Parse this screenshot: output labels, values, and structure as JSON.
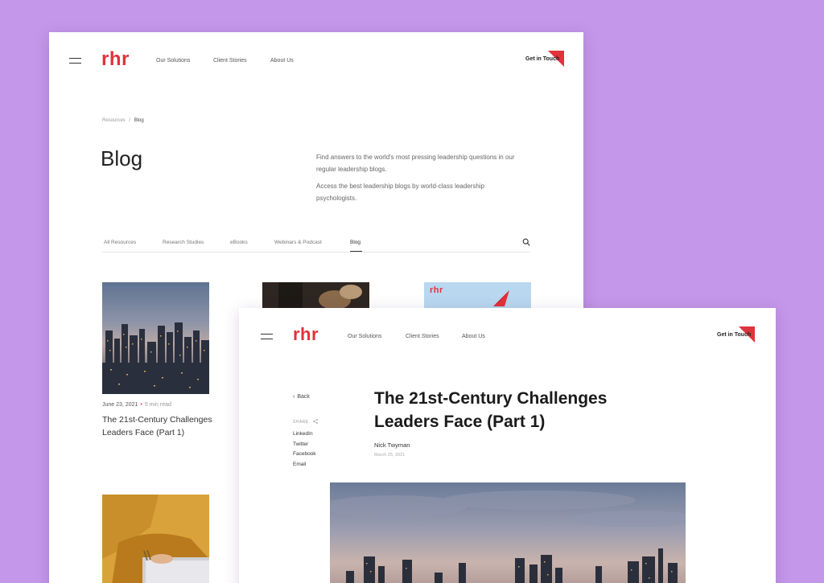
{
  "brand": {
    "logo": "rhr",
    "accent": "#e2323c",
    "background": "#c497ea"
  },
  "nav": {
    "solutions": "Our Solutions",
    "stories": "Client Stories",
    "about": "About Us",
    "cta": "Get in Touch"
  },
  "listing": {
    "breadcrumb": {
      "parent": "Resources",
      "separator": "/",
      "current": "Blog"
    },
    "title": "Blog",
    "intro_1": "Find answers to the world's most pressing leadership questions in our regular leadership blogs.",
    "intro_2": "Access the best leadership blogs by world-class leadership psychologists.",
    "filters": [
      "All Resources",
      "Research Studies",
      "eBooks",
      "Webinars & Podcast",
      "Blog"
    ],
    "active_filter": "Blog",
    "card": {
      "date": "June 23, 2021",
      "read_time": "5 min read",
      "title": "The 21st-Century Challenges Leaders Face (Part 1)"
    },
    "thumb_logo": "rhr"
  },
  "article": {
    "back": "Back",
    "share_label": "SHARE",
    "share_links": [
      "LinkedIn",
      "Twitter",
      "Facebook",
      "Email"
    ],
    "title": "The 21st-Century Challenges Leaders Face (Part 1)",
    "author": "Nick Twyman",
    "date": "March 25, 2021"
  }
}
